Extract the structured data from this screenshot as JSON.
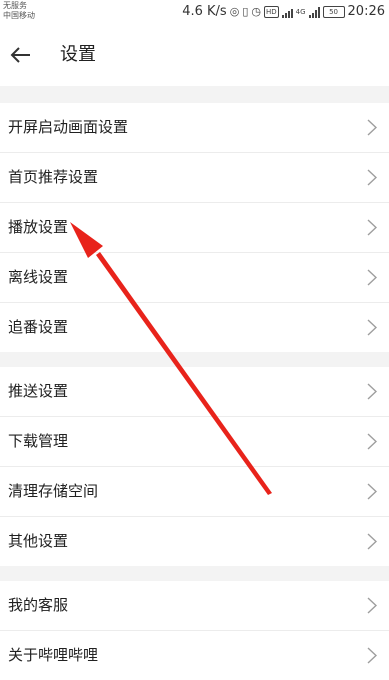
{
  "status_bar": {
    "carrier_line1": "无服务",
    "carrier_line2": "中国移动",
    "net_speed": "4.6 K/s",
    "hd_badge": "HD",
    "network_type": "4G",
    "battery_level": "50",
    "time": "20:26"
  },
  "header": {
    "back_icon": "arrow-left-icon",
    "title": "设置"
  },
  "groups": [
    {
      "items": [
        {
          "label": "开屏启动画面设置"
        },
        {
          "label": "首页推荐设置"
        },
        {
          "label": "播放设置"
        },
        {
          "label": "离线设置"
        },
        {
          "label": "追番设置"
        }
      ]
    },
    {
      "items": [
        {
          "label": "推送设置"
        },
        {
          "label": "下载管理"
        },
        {
          "label": "清理存储空间"
        },
        {
          "label": "其他设置"
        }
      ]
    },
    {
      "items": [
        {
          "label": "我的客服"
        },
        {
          "label": "关于哔哩哔哩"
        }
      ]
    }
  ],
  "colors": {
    "background": "#f3f3f3",
    "surface": "#ffffff",
    "text": "#212121",
    "chevron": "#9e9e9e",
    "annotation_arrow": "#e8231b"
  }
}
